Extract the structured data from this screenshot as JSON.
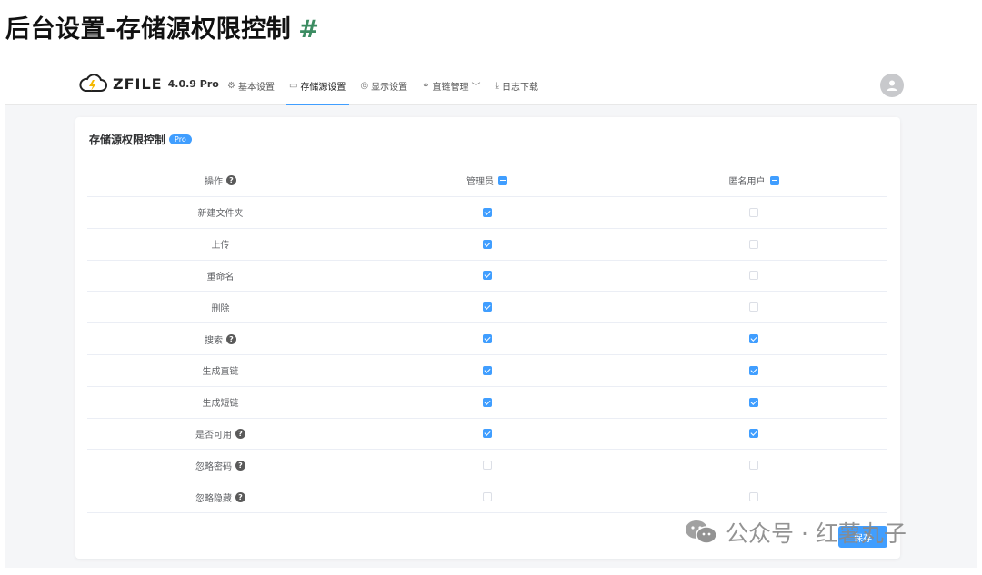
{
  "doc": {
    "title": "后台设置-存储源权限控制",
    "hash": "#"
  },
  "app": {
    "name": "ZFILE",
    "version": "4.0.9 Pro"
  },
  "nav": {
    "items": [
      {
        "icon": "⚙",
        "label": "基本设置",
        "active": false
      },
      {
        "icon": "▭",
        "label": "存储源设置",
        "active": true
      },
      {
        "icon": "◎",
        "label": "显示设置",
        "active": false
      },
      {
        "icon": "⚭",
        "label": "直链管理",
        "active": false,
        "dropdown": "﹀"
      },
      {
        "icon": "⤓",
        "label": "日志下载",
        "active": false
      }
    ]
  },
  "card": {
    "title": "存储源权限控制",
    "badge": "Pro"
  },
  "table": {
    "headers": {
      "operation": "操作",
      "admin": "管理员",
      "anonymous": "匿名用户"
    },
    "rows": [
      {
        "label": "新建文件夹",
        "help": false,
        "admin": true,
        "anonymous": false
      },
      {
        "label": "上传",
        "help": false,
        "admin": true,
        "anonymous": false
      },
      {
        "label": "重命名",
        "help": false,
        "admin": true,
        "anonymous": false
      },
      {
        "label": "删除",
        "help": false,
        "admin": true,
        "anonymous": false
      },
      {
        "label": "搜索",
        "help": true,
        "admin": true,
        "anonymous": true
      },
      {
        "label": "生成直链",
        "help": false,
        "admin": true,
        "anonymous": true
      },
      {
        "label": "生成短链",
        "help": false,
        "admin": true,
        "anonymous": true
      },
      {
        "label": "是否可用",
        "help": true,
        "admin": true,
        "anonymous": true
      },
      {
        "label": "忽略密码",
        "help": true,
        "admin": false,
        "anonymous": false
      },
      {
        "label": "忽略隐藏",
        "help": true,
        "admin": false,
        "anonymous": false
      }
    ]
  },
  "buttons": {
    "save": "保存"
  },
  "watermark": {
    "text": "公众号 · 红薯丸子"
  },
  "colors": {
    "accent": "#409eff",
    "hash": "#3c8c62"
  }
}
